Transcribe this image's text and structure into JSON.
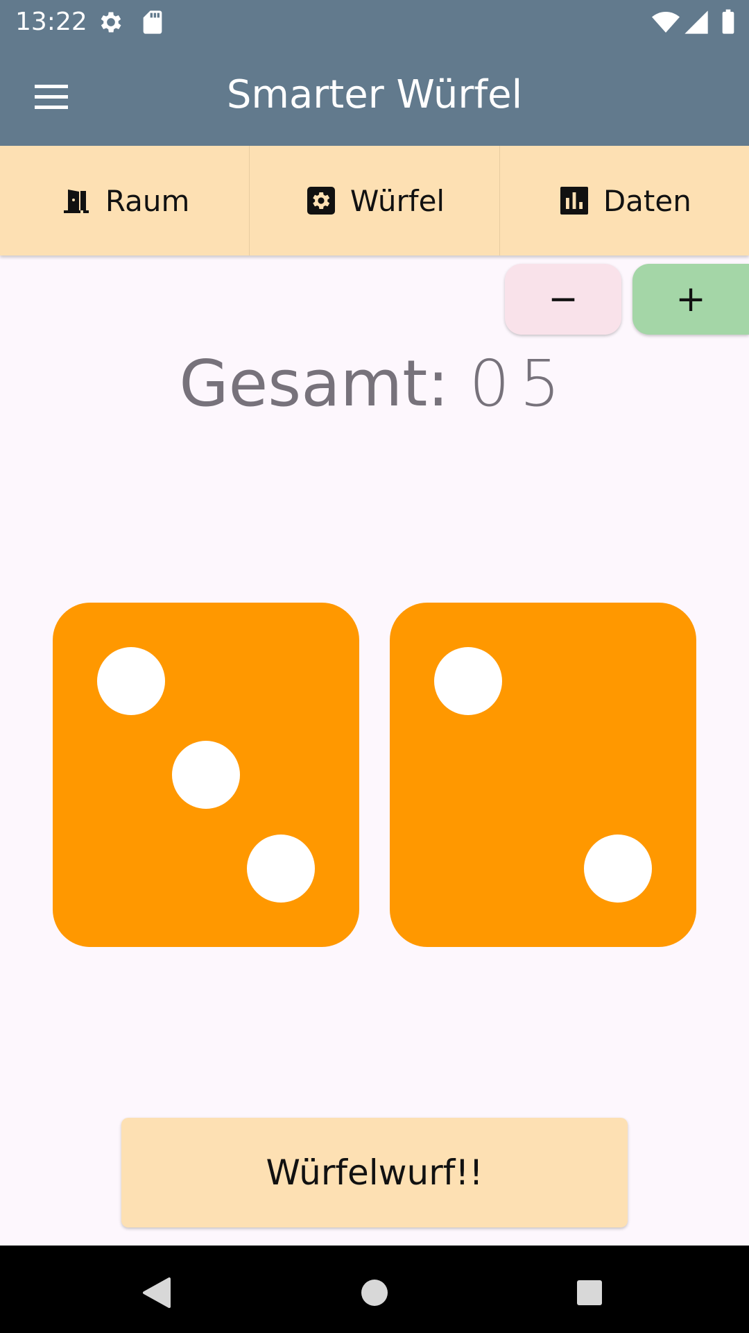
{
  "status_bar": {
    "time": "13:22",
    "icons": [
      "settings-icon",
      "sd-card-icon",
      "wifi-icon",
      "signal-icon",
      "battery-icon"
    ]
  },
  "app_bar": {
    "title": "Smarter Würfel",
    "menu_icon": "menu-icon"
  },
  "tabs": [
    {
      "label": "Raum",
      "icon": "door-icon"
    },
    {
      "label": "Würfel",
      "icon": "die-settings-icon"
    },
    {
      "label": "Daten",
      "icon": "bar-chart-icon"
    }
  ],
  "stepper": {
    "minus_label": "−",
    "plus_label": "+"
  },
  "total": {
    "label": "Gesamt:",
    "value": "05"
  },
  "dice": [
    {
      "value": 3
    },
    {
      "value": 2
    }
  ],
  "roll_button": {
    "label": "Würfelwurf!!"
  },
  "nav_bar": {
    "icons": [
      "back-icon",
      "home-icon",
      "recents-icon"
    ]
  },
  "colors": {
    "app_bar": "#627a8d",
    "tab_bar": "#fde0b3",
    "die": "#ff9800",
    "minus_button": "#f9e2ea",
    "plus_button": "#a4d6a7",
    "background": "#fdf7fd"
  }
}
